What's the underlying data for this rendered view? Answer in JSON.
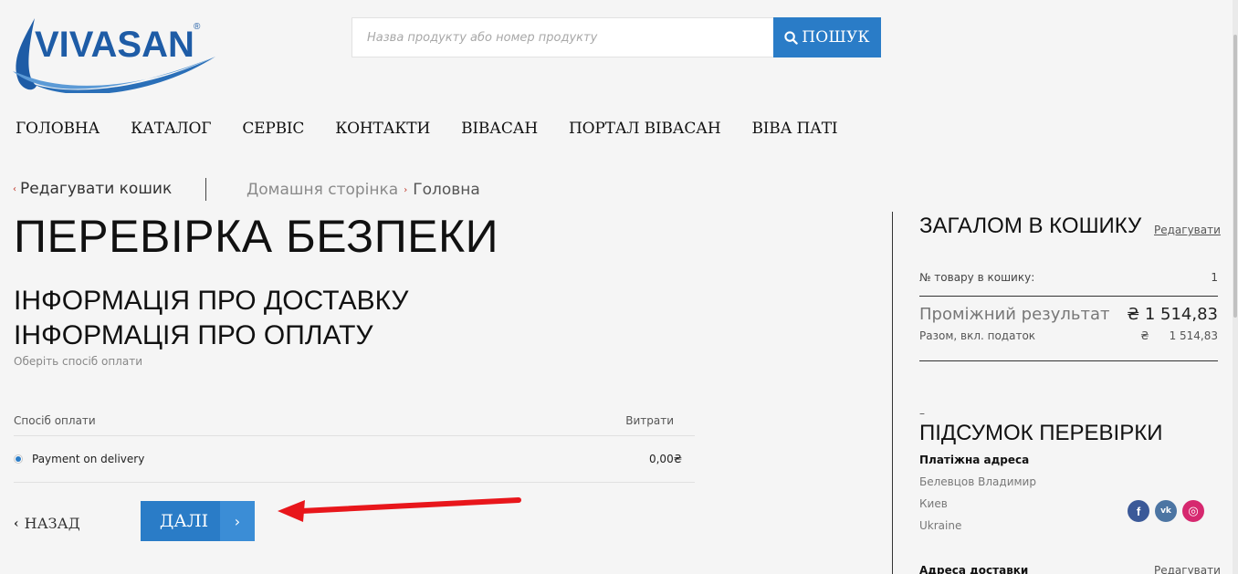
{
  "brand": {
    "logo_text": "VIVASAN",
    "logo_mark": "®"
  },
  "search": {
    "placeholder": "Назва продукту або номер продукту",
    "button_label": "ПОШУК"
  },
  "nav": [
    "ГОЛОВНА",
    "КАТАЛОГ",
    "СЕРВІС",
    "КОНТАКТИ",
    "ВІВАСАН",
    "ПОРТАЛ ВІВАСАН",
    "ВІВА ПАТІ"
  ],
  "breadcrumb": {
    "edit_cart": "Редагувати кошик",
    "home": "Домашня сторінка",
    "current": "Головна"
  },
  "page": {
    "title": "ПЕРЕВІРКА БЕЗПЕКИ",
    "shipping_heading": "ІНФОРМАЦІЯ ПРО ДОСТАВКУ",
    "payment_heading": "ІНФОРМАЦІЯ ПРО ОПЛАТУ",
    "payment_subtitle": "Оберіть спосіб оплати"
  },
  "payment_table": {
    "col_method": "Спосіб оплати",
    "col_cost": "Витрати",
    "rows": [
      {
        "method": "Payment on delivery",
        "cost": "0,00₴",
        "selected": true
      }
    ]
  },
  "actions": {
    "back": "НАЗАД",
    "next": "ДАЛІ"
  },
  "cart_summary": {
    "title": "ЗАГАЛОМ В КОШИКУ",
    "edit": "Редагувати",
    "items_label": "№ товару в кошику:",
    "items_value": "1",
    "subtotal_label": "Проміжний результат",
    "subtotal_value": "₴ 1 514,83",
    "tax_label": "Разом, вкл. податок",
    "tax_currency": "₴",
    "tax_value": "1 514,83"
  },
  "checkout_summary": {
    "dash": "–",
    "title": "ПІДСУМОК ПЕРЕВІРКИ",
    "billing_label": "Платіжна адреса",
    "billing_lines": [
      "Белевцов Владимир",
      "Киев",
      "Ukraine"
    ],
    "shipping_label": "Адреса доставки",
    "shipping_edit": "Редагувати"
  },
  "social": {
    "facebook": "f",
    "vk": "vk",
    "instagram": "◎"
  },
  "colors": {
    "primary": "#2a7cc7",
    "arrow": "#e8161b",
    "background": "#f5f5f5"
  }
}
